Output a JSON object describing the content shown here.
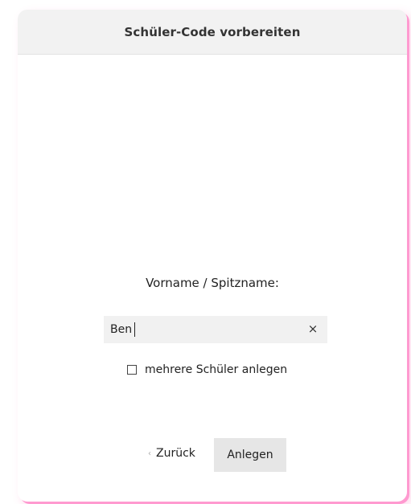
{
  "dialog": {
    "title": "Schüler-Code vorbereiten",
    "name_label": "Vorname / Spitzname:",
    "name_input": {
      "value": "Ben",
      "placeholder": ""
    },
    "clear_icon": "×",
    "multiple_checkbox": {
      "label": "mehrere Schüler anlegen",
      "checked": false
    },
    "back": {
      "chevron": "‹",
      "label": "Zurück"
    },
    "create_label": "Anlegen"
  },
  "colors": {
    "header_bg": "#f2f2f2",
    "input_bg": "#f1f1f1",
    "button_bg": "#e6e6e6",
    "accent_shadow": "#ff9ad0"
  }
}
